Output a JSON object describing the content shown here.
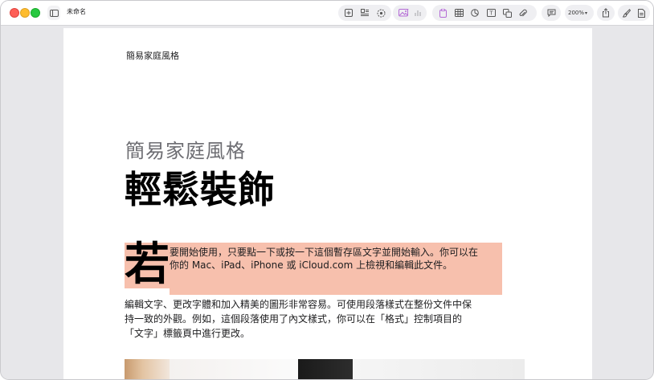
{
  "window": {
    "title": "未命名"
  },
  "toolbar": {
    "zoom_label": "200%",
    "zoom_chevron": "⌄"
  },
  "document": {
    "header": "簡易家庭風格",
    "subtitle": "簡易家庭風格",
    "title": "輕鬆裝飾",
    "drop_cap": "若",
    "para1_line1": "要開始使用，只要點一下或按一下這個暫存區文字並開始輸入。你可以在",
    "para1_line2": "你的 Mac、iPad、iPhone 或 iCloud.com 上檢視和編輯此文件。",
    "para2_line1": "編輯文字、更改字體和加入精美的圖形非常容易。可使用段落樣式在整份文件中保",
    "para2_line2": "持一致的外觀。例如，這個段落使用了內文樣式，你可以在「格式」控制項目的",
    "para2_line3": "「文字」標籤頁中進行更改。"
  },
  "colors": {
    "highlight": "#f7c0ad",
    "accent_purple": "#b46bd6"
  }
}
